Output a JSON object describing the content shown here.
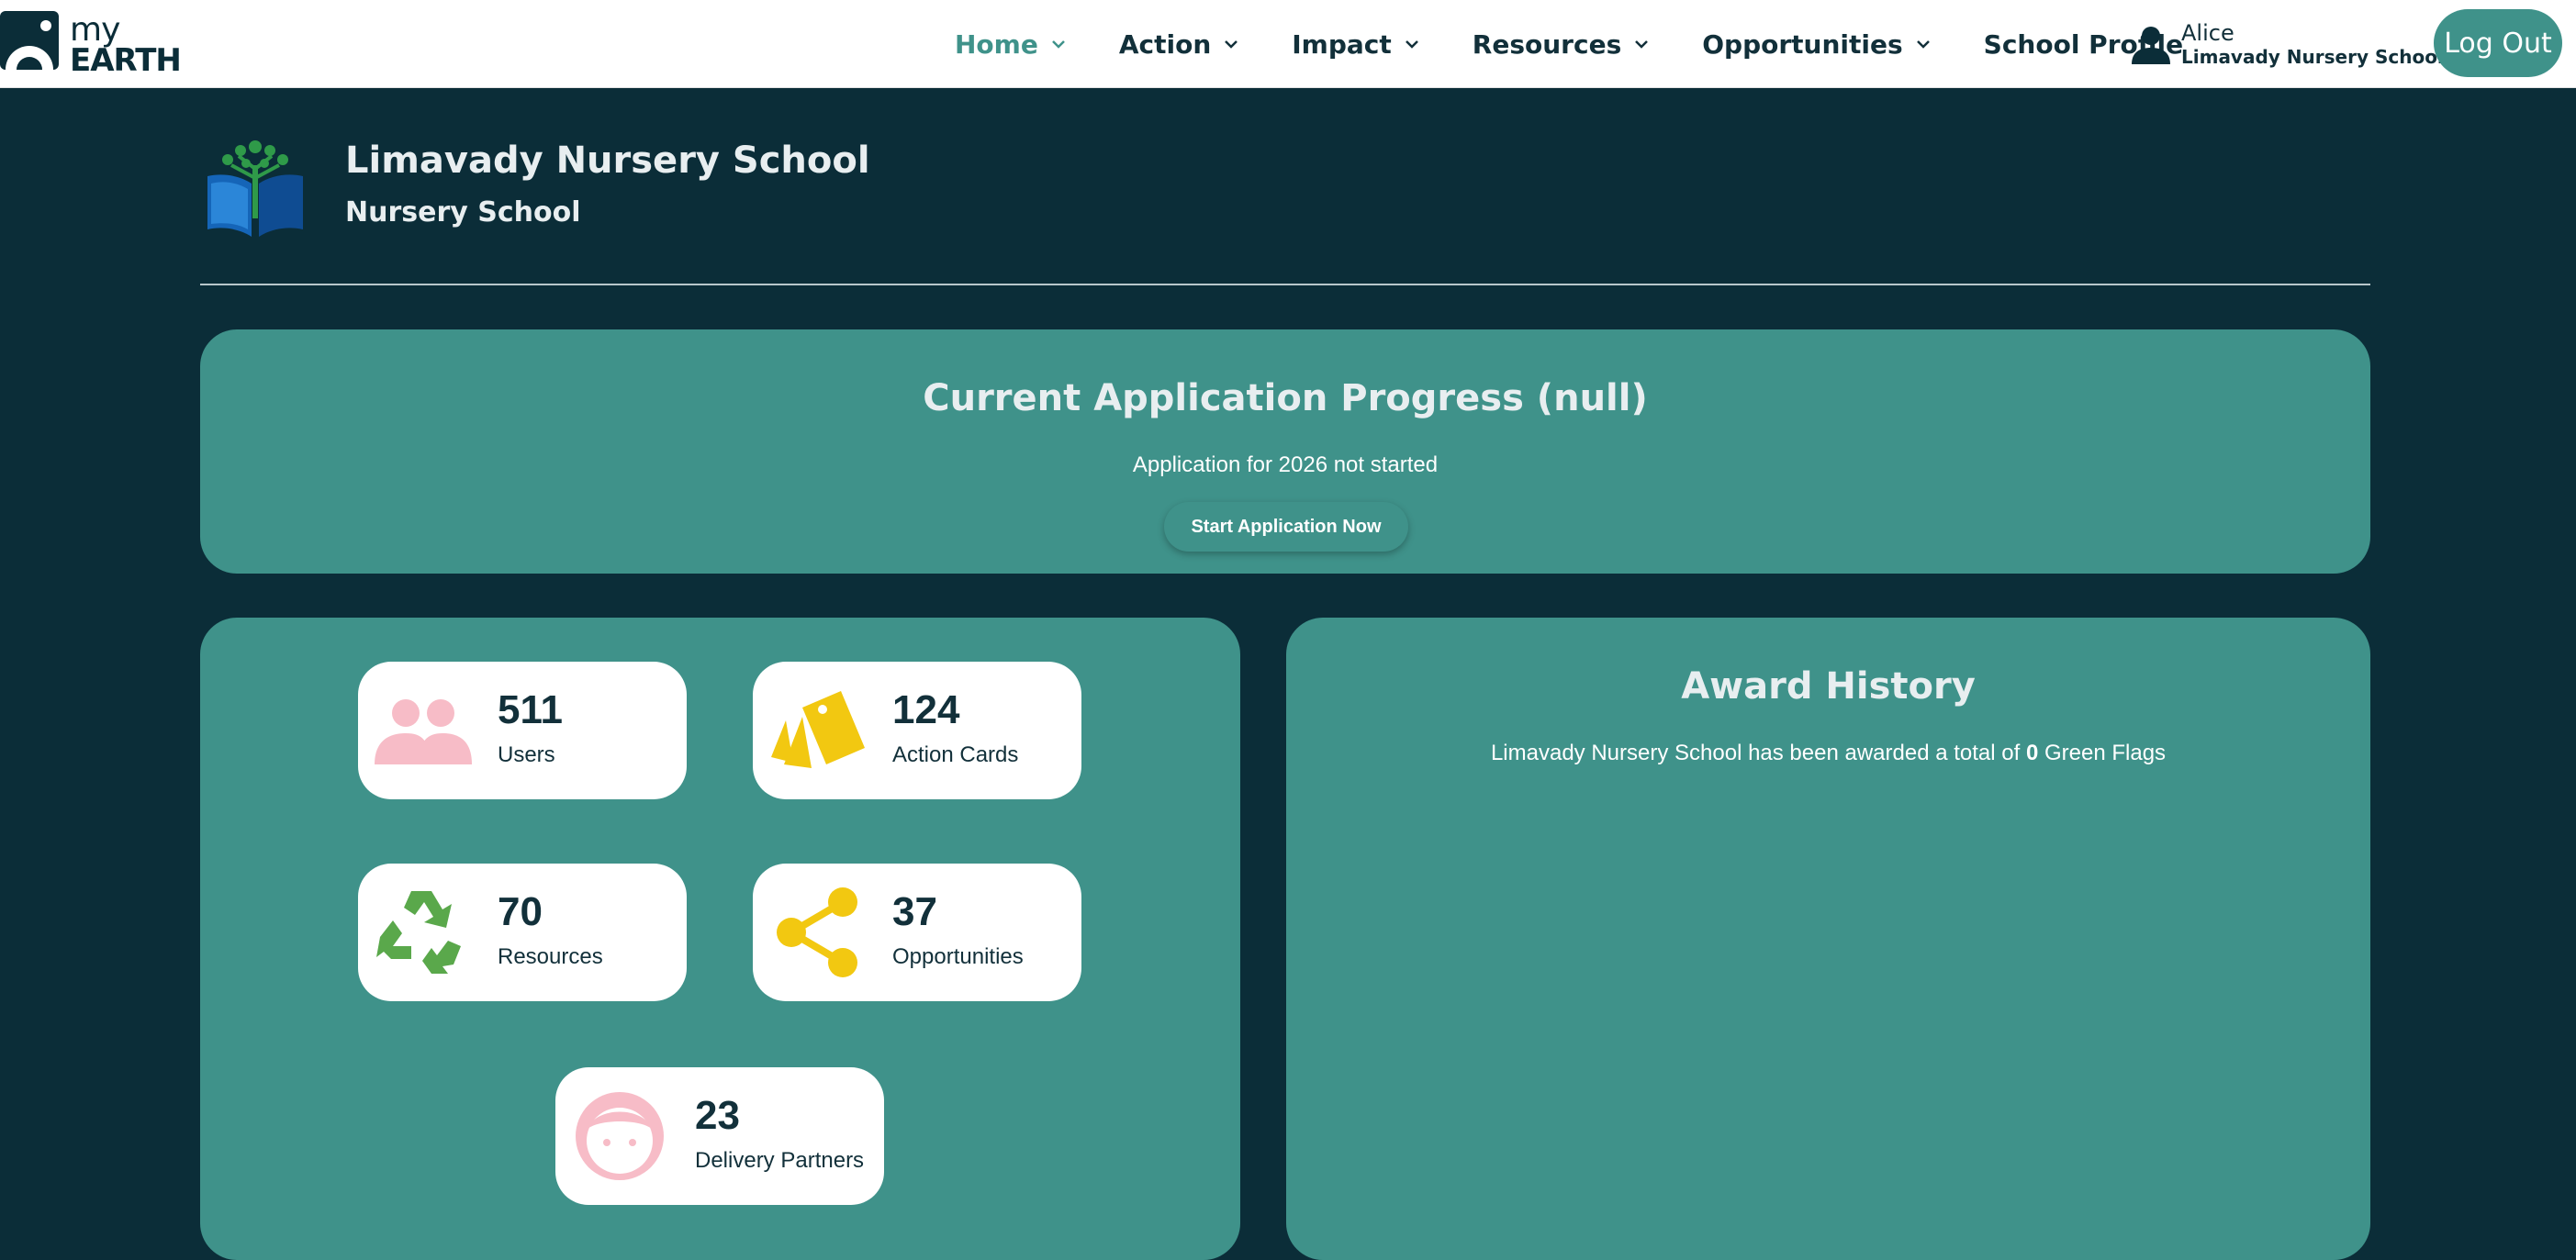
{
  "header": {
    "logo": {
      "line1": "my",
      "line2": "EARTH"
    },
    "nav": [
      {
        "label": "Home",
        "has_dropdown": true,
        "active": true
      },
      {
        "label": "Action",
        "has_dropdown": true,
        "active": false
      },
      {
        "label": "Impact",
        "has_dropdown": true,
        "active": false
      },
      {
        "label": "Resources",
        "has_dropdown": true,
        "active": false
      },
      {
        "label": "Opportunities",
        "has_dropdown": true,
        "active": false
      },
      {
        "label": "School Profile",
        "has_dropdown": false,
        "active": false
      }
    ],
    "user": {
      "name": "Alice",
      "school": "Limavady Nursery School"
    },
    "logout_label": "Log Out"
  },
  "school": {
    "name": "Limavady Nursery School",
    "type": "Nursery School"
  },
  "progress": {
    "title": "Current Application Progress (null)",
    "status": "Application for 2026 not started",
    "button_label": "Start Application Now"
  },
  "stats": [
    {
      "value": "511",
      "label": "Users",
      "icon": "users-icon",
      "color": "#f7bcc7"
    },
    {
      "value": "124",
      "label": "Action Cards",
      "icon": "cards-icon",
      "color": "#f2c811"
    },
    {
      "value": "70",
      "label": "Resources",
      "icon": "recycle-icon",
      "color": "#5aa84b"
    },
    {
      "value": "37",
      "label": "Opportunities",
      "icon": "share-icon",
      "color": "#f2c811"
    },
    {
      "value": "23",
      "label": "Delivery Partners",
      "icon": "face-icon",
      "color": "#f7bcc7"
    }
  ],
  "awards": {
    "title": "Award History",
    "text_prefix": "Limavady Nursery School has been awarded a total of ",
    "count": "0",
    "text_suffix": " Green Flags"
  },
  "colors": {
    "background": "#0b2d38",
    "panel": "#3f928a",
    "accent": "#3f928a",
    "text_dark": "#12303a"
  }
}
